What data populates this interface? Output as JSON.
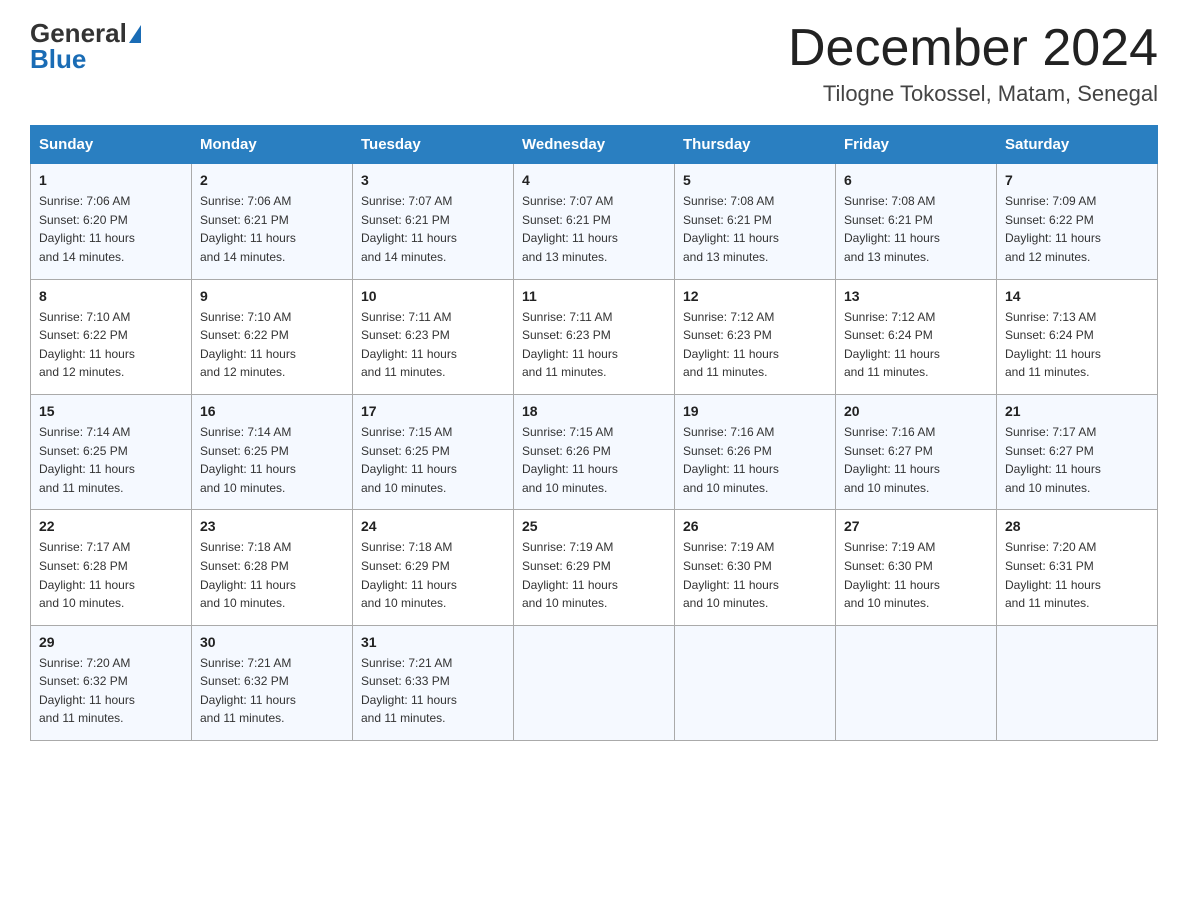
{
  "header": {
    "logo_general": "General",
    "logo_blue": "Blue",
    "month_year": "December 2024",
    "location": "Tilogne Tokossel, Matam, Senegal"
  },
  "days_of_week": [
    "Sunday",
    "Monday",
    "Tuesday",
    "Wednesday",
    "Thursday",
    "Friday",
    "Saturday"
  ],
  "weeks": [
    [
      {
        "num": "1",
        "sunrise": "7:06 AM",
        "sunset": "6:20 PM",
        "daylight": "11 hours and 14 minutes."
      },
      {
        "num": "2",
        "sunrise": "7:06 AM",
        "sunset": "6:21 PM",
        "daylight": "11 hours and 14 minutes."
      },
      {
        "num": "3",
        "sunrise": "7:07 AM",
        "sunset": "6:21 PM",
        "daylight": "11 hours and 14 minutes."
      },
      {
        "num": "4",
        "sunrise": "7:07 AM",
        "sunset": "6:21 PM",
        "daylight": "11 hours and 13 minutes."
      },
      {
        "num": "5",
        "sunrise": "7:08 AM",
        "sunset": "6:21 PM",
        "daylight": "11 hours and 13 minutes."
      },
      {
        "num": "6",
        "sunrise": "7:08 AM",
        "sunset": "6:21 PM",
        "daylight": "11 hours and 13 minutes."
      },
      {
        "num": "7",
        "sunrise": "7:09 AM",
        "sunset": "6:22 PM",
        "daylight": "11 hours and 12 minutes."
      }
    ],
    [
      {
        "num": "8",
        "sunrise": "7:10 AM",
        "sunset": "6:22 PM",
        "daylight": "11 hours and 12 minutes."
      },
      {
        "num": "9",
        "sunrise": "7:10 AM",
        "sunset": "6:22 PM",
        "daylight": "11 hours and 12 minutes."
      },
      {
        "num": "10",
        "sunrise": "7:11 AM",
        "sunset": "6:23 PM",
        "daylight": "11 hours and 11 minutes."
      },
      {
        "num": "11",
        "sunrise": "7:11 AM",
        "sunset": "6:23 PM",
        "daylight": "11 hours and 11 minutes."
      },
      {
        "num": "12",
        "sunrise": "7:12 AM",
        "sunset": "6:23 PM",
        "daylight": "11 hours and 11 minutes."
      },
      {
        "num": "13",
        "sunrise": "7:12 AM",
        "sunset": "6:24 PM",
        "daylight": "11 hours and 11 minutes."
      },
      {
        "num": "14",
        "sunrise": "7:13 AM",
        "sunset": "6:24 PM",
        "daylight": "11 hours and 11 minutes."
      }
    ],
    [
      {
        "num": "15",
        "sunrise": "7:14 AM",
        "sunset": "6:25 PM",
        "daylight": "11 hours and 11 minutes."
      },
      {
        "num": "16",
        "sunrise": "7:14 AM",
        "sunset": "6:25 PM",
        "daylight": "11 hours and 10 minutes."
      },
      {
        "num": "17",
        "sunrise": "7:15 AM",
        "sunset": "6:25 PM",
        "daylight": "11 hours and 10 minutes."
      },
      {
        "num": "18",
        "sunrise": "7:15 AM",
        "sunset": "6:26 PM",
        "daylight": "11 hours and 10 minutes."
      },
      {
        "num": "19",
        "sunrise": "7:16 AM",
        "sunset": "6:26 PM",
        "daylight": "11 hours and 10 minutes."
      },
      {
        "num": "20",
        "sunrise": "7:16 AM",
        "sunset": "6:27 PM",
        "daylight": "11 hours and 10 minutes."
      },
      {
        "num": "21",
        "sunrise": "7:17 AM",
        "sunset": "6:27 PM",
        "daylight": "11 hours and 10 minutes."
      }
    ],
    [
      {
        "num": "22",
        "sunrise": "7:17 AM",
        "sunset": "6:28 PM",
        "daylight": "11 hours and 10 minutes."
      },
      {
        "num": "23",
        "sunrise": "7:18 AM",
        "sunset": "6:28 PM",
        "daylight": "11 hours and 10 minutes."
      },
      {
        "num": "24",
        "sunrise": "7:18 AM",
        "sunset": "6:29 PM",
        "daylight": "11 hours and 10 minutes."
      },
      {
        "num": "25",
        "sunrise": "7:19 AM",
        "sunset": "6:29 PM",
        "daylight": "11 hours and 10 minutes."
      },
      {
        "num": "26",
        "sunrise": "7:19 AM",
        "sunset": "6:30 PM",
        "daylight": "11 hours and 10 minutes."
      },
      {
        "num": "27",
        "sunrise": "7:19 AM",
        "sunset": "6:30 PM",
        "daylight": "11 hours and 10 minutes."
      },
      {
        "num": "28",
        "sunrise": "7:20 AM",
        "sunset": "6:31 PM",
        "daylight": "11 hours and 11 minutes."
      }
    ],
    [
      {
        "num": "29",
        "sunrise": "7:20 AM",
        "sunset": "6:32 PM",
        "daylight": "11 hours and 11 minutes."
      },
      {
        "num": "30",
        "sunrise": "7:21 AM",
        "sunset": "6:32 PM",
        "daylight": "11 hours and 11 minutes."
      },
      {
        "num": "31",
        "sunrise": "7:21 AM",
        "sunset": "6:33 PM",
        "daylight": "11 hours and 11 minutes."
      },
      null,
      null,
      null,
      null
    ]
  ]
}
